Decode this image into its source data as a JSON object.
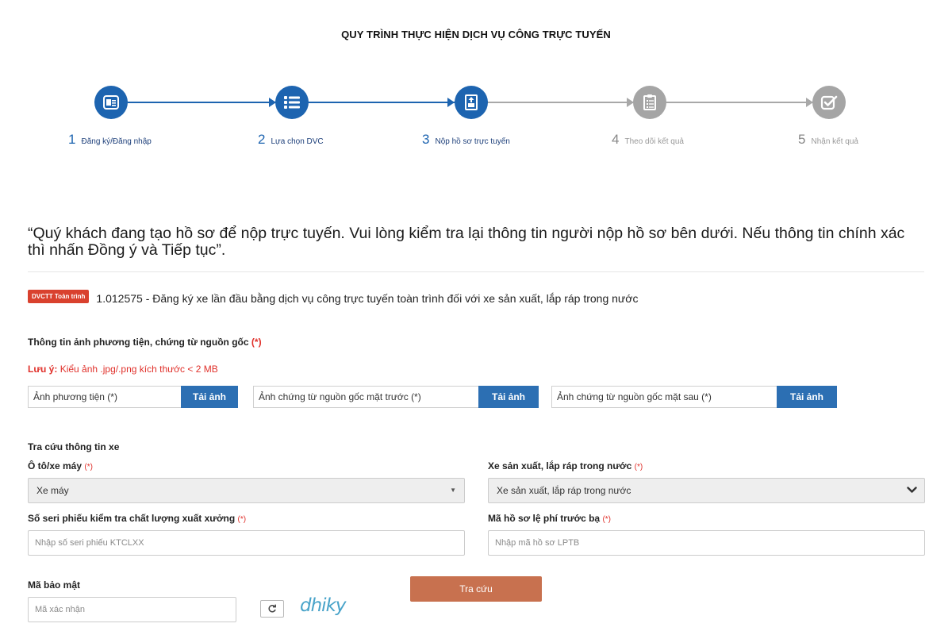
{
  "title": "QUY TRÌNH THỰC HIỆN DỊCH VỤ CÔNG TRỰC TUYẾN",
  "steps": [
    {
      "num": "1",
      "label": "Đăng ký/Đăng nhập",
      "icon": "id-card-icon",
      "state": "done"
    },
    {
      "num": "2",
      "label": "Lựa chọn DVC",
      "icon": "list-icon",
      "state": "done"
    },
    {
      "num": "3",
      "label": "Nộp hồ sơ trực tuyến",
      "icon": "upload-document-icon",
      "state": "done"
    },
    {
      "num": "4",
      "label": "Theo dõi kết quả",
      "icon": "clipboard-icon",
      "state": "todo"
    },
    {
      "num": "5",
      "label": "Nhận kết quả",
      "icon": "check-box-icon",
      "state": "todo"
    }
  ],
  "notice": "“Quý khách đang tạo hồ sơ để nộp trực tuyến. Vui lòng kiểm tra lại thông tin người nộp hồ sơ bên dưới. Nếu thông tin chính xác thì nhấn Đồng ý và Tiếp tục”.",
  "service": {
    "badge": "DVCTT Toàn trình",
    "text": "1.012575 - Đăng ký xe lần đầu bằng dịch vụ công trực tuyến toàn trình đối với xe sản xuất, lắp ráp trong nước"
  },
  "photos": {
    "title": "Thông tin ảnh phương tiện, chứng từ nguồn gốc",
    "required_mark": "(*)",
    "note_prefix": "Lưu ý:",
    "note_text": " Kiểu ảnh .jpg/.png kích thước < 2 MB",
    "uploads": [
      {
        "label": "Ảnh phương tiện (*)",
        "button": "Tải ảnh"
      },
      {
        "label": "Ảnh chứng từ nguồn gốc mặt trước (*)",
        "button": "Tải ảnh"
      },
      {
        "label": "Ảnh chứng từ nguồn gốc mặt sau (*)",
        "button": "Tải ảnh"
      }
    ]
  },
  "lookup": {
    "title": "Tra cứu thông tin xe",
    "vehicle_type": {
      "label": "Ô tô/xe máy",
      "required_mark": "(*)",
      "value": "Xe máy"
    },
    "origin": {
      "label": "Xe sản xuất, lắp ráp trong nước",
      "required_mark": "(*)",
      "value": "Xe sản xuất, lắp ráp trong nước"
    },
    "serial": {
      "label": "Số seri phiếu kiểm tra chất lượng xuất xưởng",
      "required_mark": "(*)",
      "placeholder": "Nhập số seri phiếu KTCLXX"
    },
    "fee_code": {
      "label": "Mã hồ sơ lệ phí trước bạ",
      "required_mark": "(*)",
      "placeholder": "Nhập mã hồ sơ LPTB"
    },
    "security": {
      "label": "Mã bảo mật",
      "placeholder": "Mã xác nhận",
      "captcha_text": "dhiky"
    },
    "search_button": "Tra cứu"
  },
  "colors": {
    "primary": "#1d64b0",
    "inactive": "#a5a5a5",
    "required": "#e0302a",
    "upload_button": "#2c6fb3",
    "search_button": "#c8714f",
    "badge": "#d9412e",
    "captcha": "#48a3c9"
  }
}
